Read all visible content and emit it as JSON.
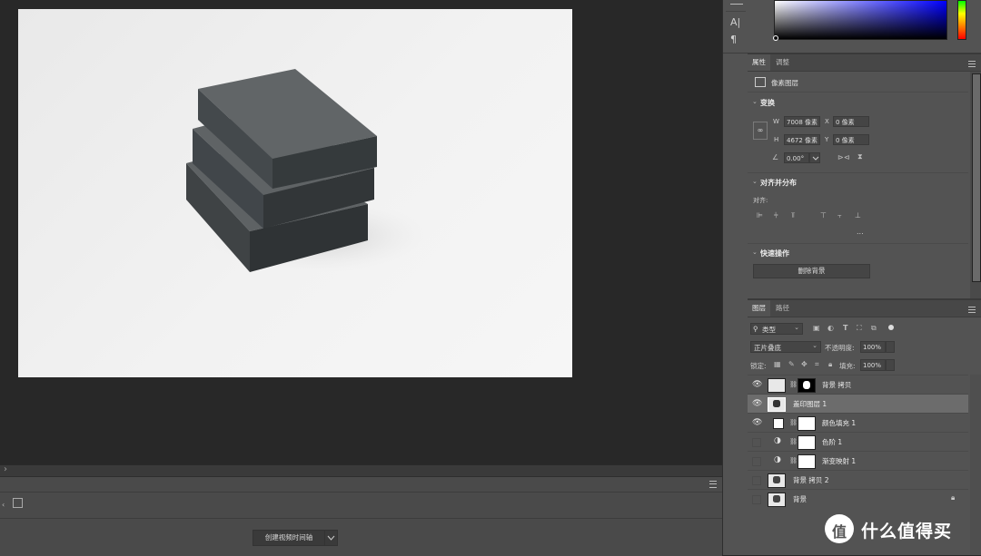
{
  "colors": {
    "accent_blue": "#0000ff",
    "panel_bg": "#535353",
    "canvas_bg": "#282828"
  },
  "properties_panel": {
    "tabs": [
      "属性",
      "调整"
    ],
    "layer_type": "像素图层",
    "transform": {
      "title": "变换",
      "w_label": "W",
      "w_value": "7008 像素",
      "x_label": "X",
      "x_value": "0 像素",
      "h_label": "H",
      "h_value": "4672 像素",
      "y_label": "Y",
      "y_value": "0 像素",
      "angle_value": "0.00°"
    },
    "align": {
      "title": "对齐并分布",
      "label": "对齐:",
      "more": "..."
    },
    "quick_actions": {
      "title": "快速操作",
      "remove_bg": "删除背景"
    }
  },
  "layers_panel": {
    "tabs": [
      "图层",
      "路径"
    ],
    "filter_kind": "类型",
    "blend_mode": "正片叠底",
    "opacity_label": "不透明度:",
    "opacity_value": "100%",
    "lock_label": "锁定:",
    "fill_label": "填充:",
    "fill_value": "100%",
    "layers": [
      {
        "name": "背景 拷贝",
        "visible": true,
        "selected": false,
        "kind": "mask"
      },
      {
        "name": "盖印图层 1",
        "visible": true,
        "selected": true,
        "kind": "pixel"
      },
      {
        "name": "颜色填充 1",
        "visible": true,
        "selected": false,
        "kind": "fill"
      },
      {
        "name": "色阶 1",
        "visible": false,
        "selected": false,
        "kind": "adjust"
      },
      {
        "name": "渐变映射 1",
        "visible": false,
        "selected": false,
        "kind": "adjust"
      },
      {
        "name": "背景 拷贝 2",
        "visible": false,
        "selected": false,
        "kind": "pixel"
      },
      {
        "name": "背景",
        "visible": false,
        "selected": false,
        "kind": "pixel",
        "locked": true
      }
    ]
  },
  "timeline": {
    "create_button": "创建视频时间轴"
  },
  "tools": {
    "text_tool": "A|",
    "paragraph": "¶"
  },
  "watermark": {
    "logo": "值",
    "text": "什么值得买"
  }
}
